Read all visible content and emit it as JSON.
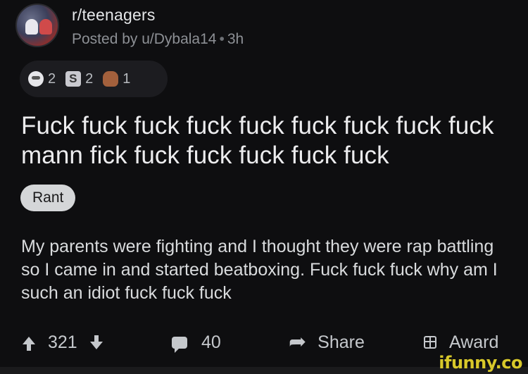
{
  "post": {
    "subreddit": "r/teenagers",
    "posted_by": "Posted by u/Dybala14",
    "age": "3h",
    "awards": [
      {
        "icon": "wholesome-award-icon",
        "count": "2"
      },
      {
        "icon": "silver-award-icon",
        "count": "2"
      },
      {
        "icon": "poop-award-icon",
        "count": "1"
      }
    ],
    "title": "Fuck fuck fuck fuck fuck fuck fuck fuck fuck mann fick fuck fuck fuck fuck fuck",
    "flair": "Rant",
    "body": "My parents were fighting and I thought they were rap battling so I  came in and started beatboxing. Fuck fuck fuck why am I such an idiot fuck fuck fuck"
  },
  "actions": {
    "votes": "321",
    "comments": "40",
    "share": "Share",
    "award": "Award"
  },
  "watermark": "ifunny.co"
}
